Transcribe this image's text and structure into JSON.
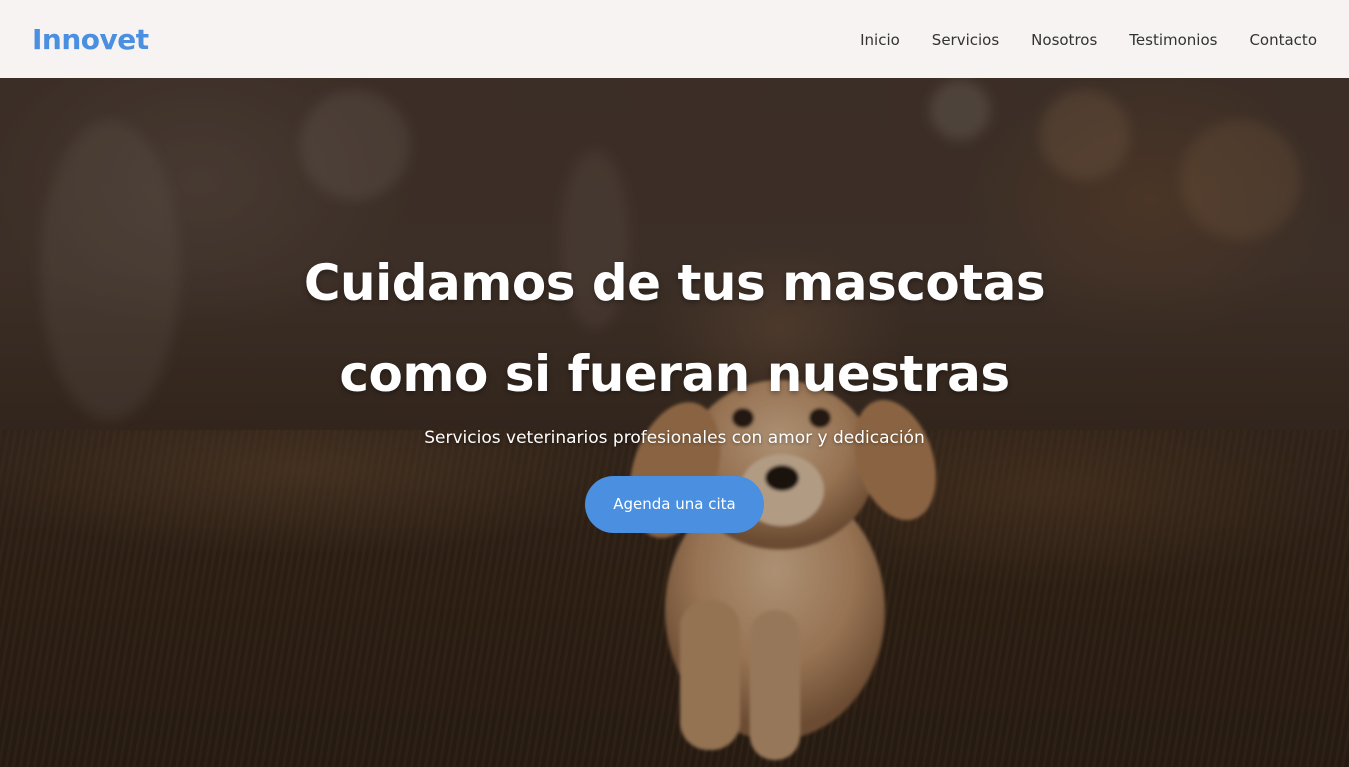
{
  "brand": {
    "name": "Innovet"
  },
  "nav": {
    "items": [
      {
        "label": "Inicio"
      },
      {
        "label": "Servicios"
      },
      {
        "label": "Nosotros"
      },
      {
        "label": "Testimonios"
      },
      {
        "label": "Contacto"
      }
    ]
  },
  "hero": {
    "title_line1": "Cuidamos de tus mascotas",
    "title_line2": "como si fueran nuestras",
    "subtitle": "Servicios veterinarios profesionales con amor y dedicación",
    "cta_label": "Agenda una cita",
    "background_image": "puppy running on grass"
  },
  "colors": {
    "accent": "#4a8fe0",
    "nav_text": "#333333",
    "nav_background": "#fcfaf9",
    "hero_text": "#ffffff"
  }
}
